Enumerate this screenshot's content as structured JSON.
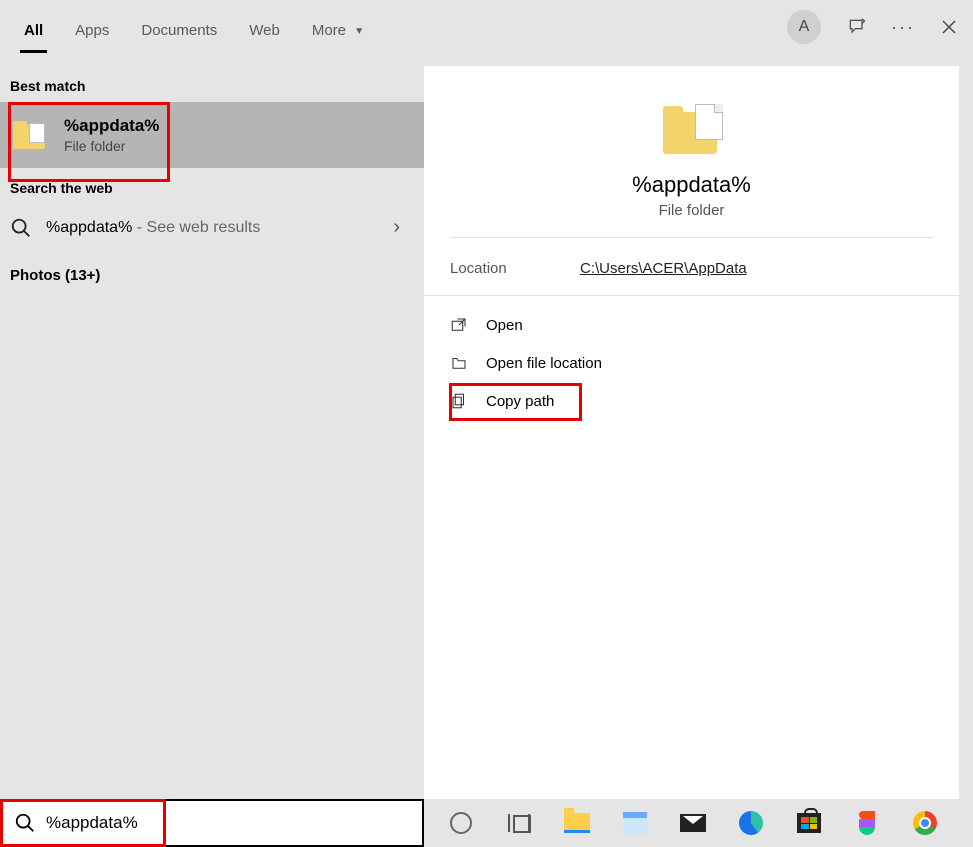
{
  "tabs": {
    "all": "All",
    "apps": "Apps",
    "documents": "Documents",
    "web": "Web",
    "more": "More"
  },
  "avatar_letter": "A",
  "left": {
    "best_match_label": "Best match",
    "best_match": {
      "title": "%appdata%",
      "subtitle": "File folder"
    },
    "search_web_label": "Search the web",
    "web_result": {
      "term": "%appdata%",
      "suffix": " - See web results"
    },
    "photos_label": "Photos (13+)"
  },
  "detail": {
    "title": "%appdata%",
    "subtitle": "File folder",
    "location_label": "Location",
    "location_value": "C:\\Users\\ACER\\AppData",
    "actions": {
      "open": "Open",
      "open_location": "Open file location",
      "copy_path": "Copy path"
    }
  },
  "search_value": "%appdata%"
}
